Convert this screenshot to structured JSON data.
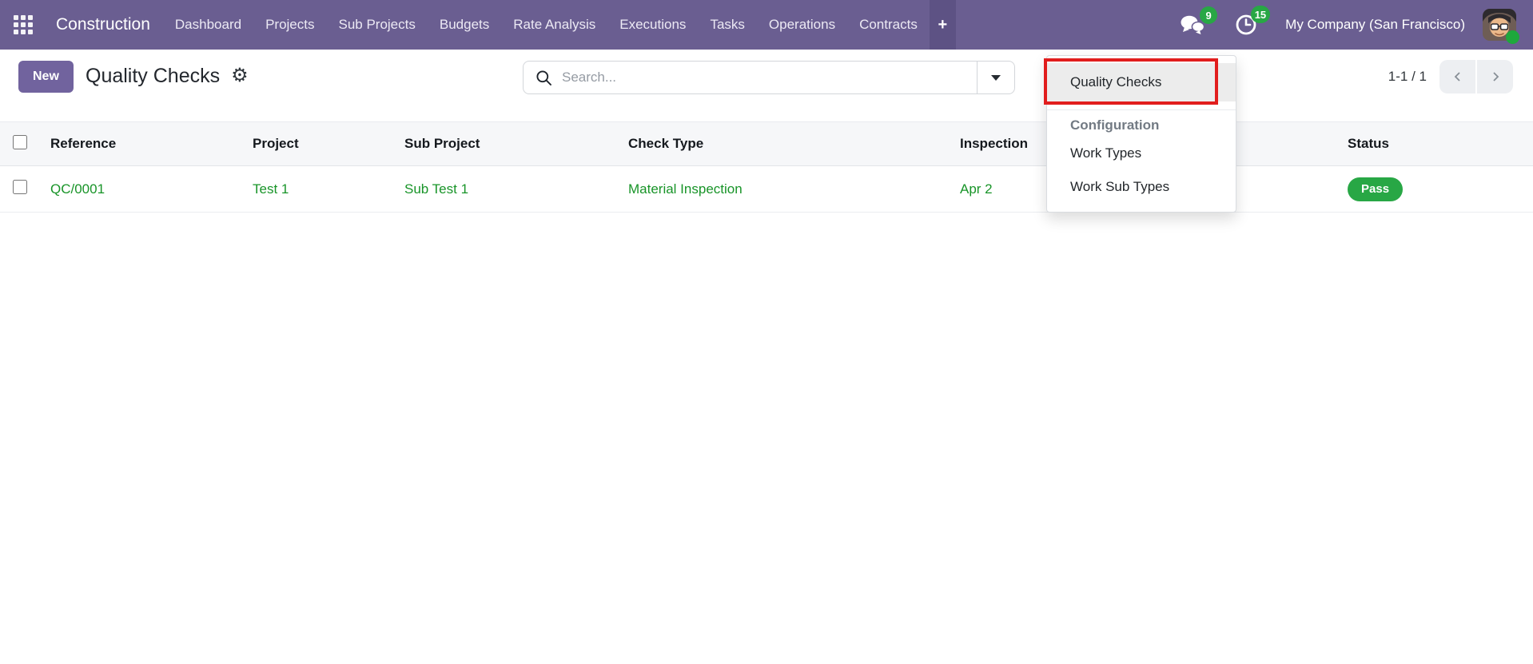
{
  "navbar": {
    "brand": "Construction",
    "menu": [
      "Dashboard",
      "Projects",
      "Sub Projects",
      "Budgets",
      "Rate Analysis",
      "Executions",
      "Tasks",
      "Operations",
      "Contracts"
    ],
    "plus": "+",
    "messages_count": "9",
    "activities_count": "15",
    "company": "My Company (San Francisco)"
  },
  "control_panel": {
    "new_button": "New",
    "title": "Quality Checks",
    "search_placeholder": "Search...",
    "pager_text": "1-1 / 1"
  },
  "dropdown_menu": {
    "active_item": "Quality Checks",
    "section_header": "Configuration",
    "items": [
      "Work Types",
      "Work Sub Types"
    ]
  },
  "table": {
    "headers": [
      "Reference",
      "Project",
      "Sub Project",
      "Check Type",
      "Inspection",
      "Status"
    ],
    "rows": [
      {
        "reference": "QC/0001",
        "project": "Test 1",
        "sub_project": "Sub Test 1",
        "check_type": "Material Inspection",
        "inspection_date": "Apr 2",
        "status": "Pass"
      }
    ]
  },
  "colors": {
    "navbar_bg": "#6a5e91",
    "primary": "#71639e",
    "success": "#28a745",
    "record_text_green": "#189428",
    "annotation_red": "#e11d1d"
  }
}
